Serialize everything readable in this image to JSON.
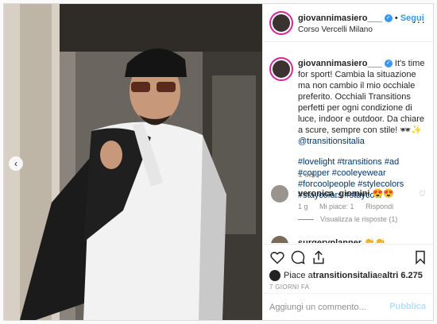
{
  "post": {
    "username": "giovannimasiero___",
    "verified_icon": "verified-badge-icon",
    "follow_separator": "•",
    "follow_label": "Segui",
    "location": "Corso Vercelli Milano",
    "more_icon": "more-options-icon"
  },
  "caption": {
    "username": "giovannimasiero___",
    "line1": " It's time for sport! Cambia la situazione ma non cambio il mio occhiale preferito. Occhiali Transitions perfetti per ogni condizione di luce, indoor e outdoor. Da chiare a scure, sempre con stile! 🕶✨ ",
    "mention": "@transitionsitalia",
    "hashtags": "#lovelight #transitions #ad #copper #cooleyewear #forcoolpeople #stylecolors #staycolors #staycool",
    "time_ago": "1 sett."
  },
  "comments": [
    {
      "username": "veronica_giomini",
      "text": " 😍😍",
      "likes": "1 g",
      "likes_label": "Mi piace: 1",
      "reply_label": "Rispondi",
      "view_replies": "Visualizza le risposte (1)"
    },
    {
      "username": "surgeryplanner",
      "text": " 👏👏"
    }
  ],
  "actions": {
    "likes_prefix": "Piace a ",
    "likes_user": "transitionsitalia",
    "likes_suffix": " e ",
    "likes_others": "altri 6.275",
    "date": "7 GIORNI FA"
  },
  "comment_box": {
    "placeholder": "Aggiungi un commento...",
    "post_label": "Pubblica"
  },
  "colors": {
    "link": "#00376b",
    "follow": "#3897f0",
    "muted": "#8e8e8e",
    "post_disabled": "#b2dffc"
  }
}
